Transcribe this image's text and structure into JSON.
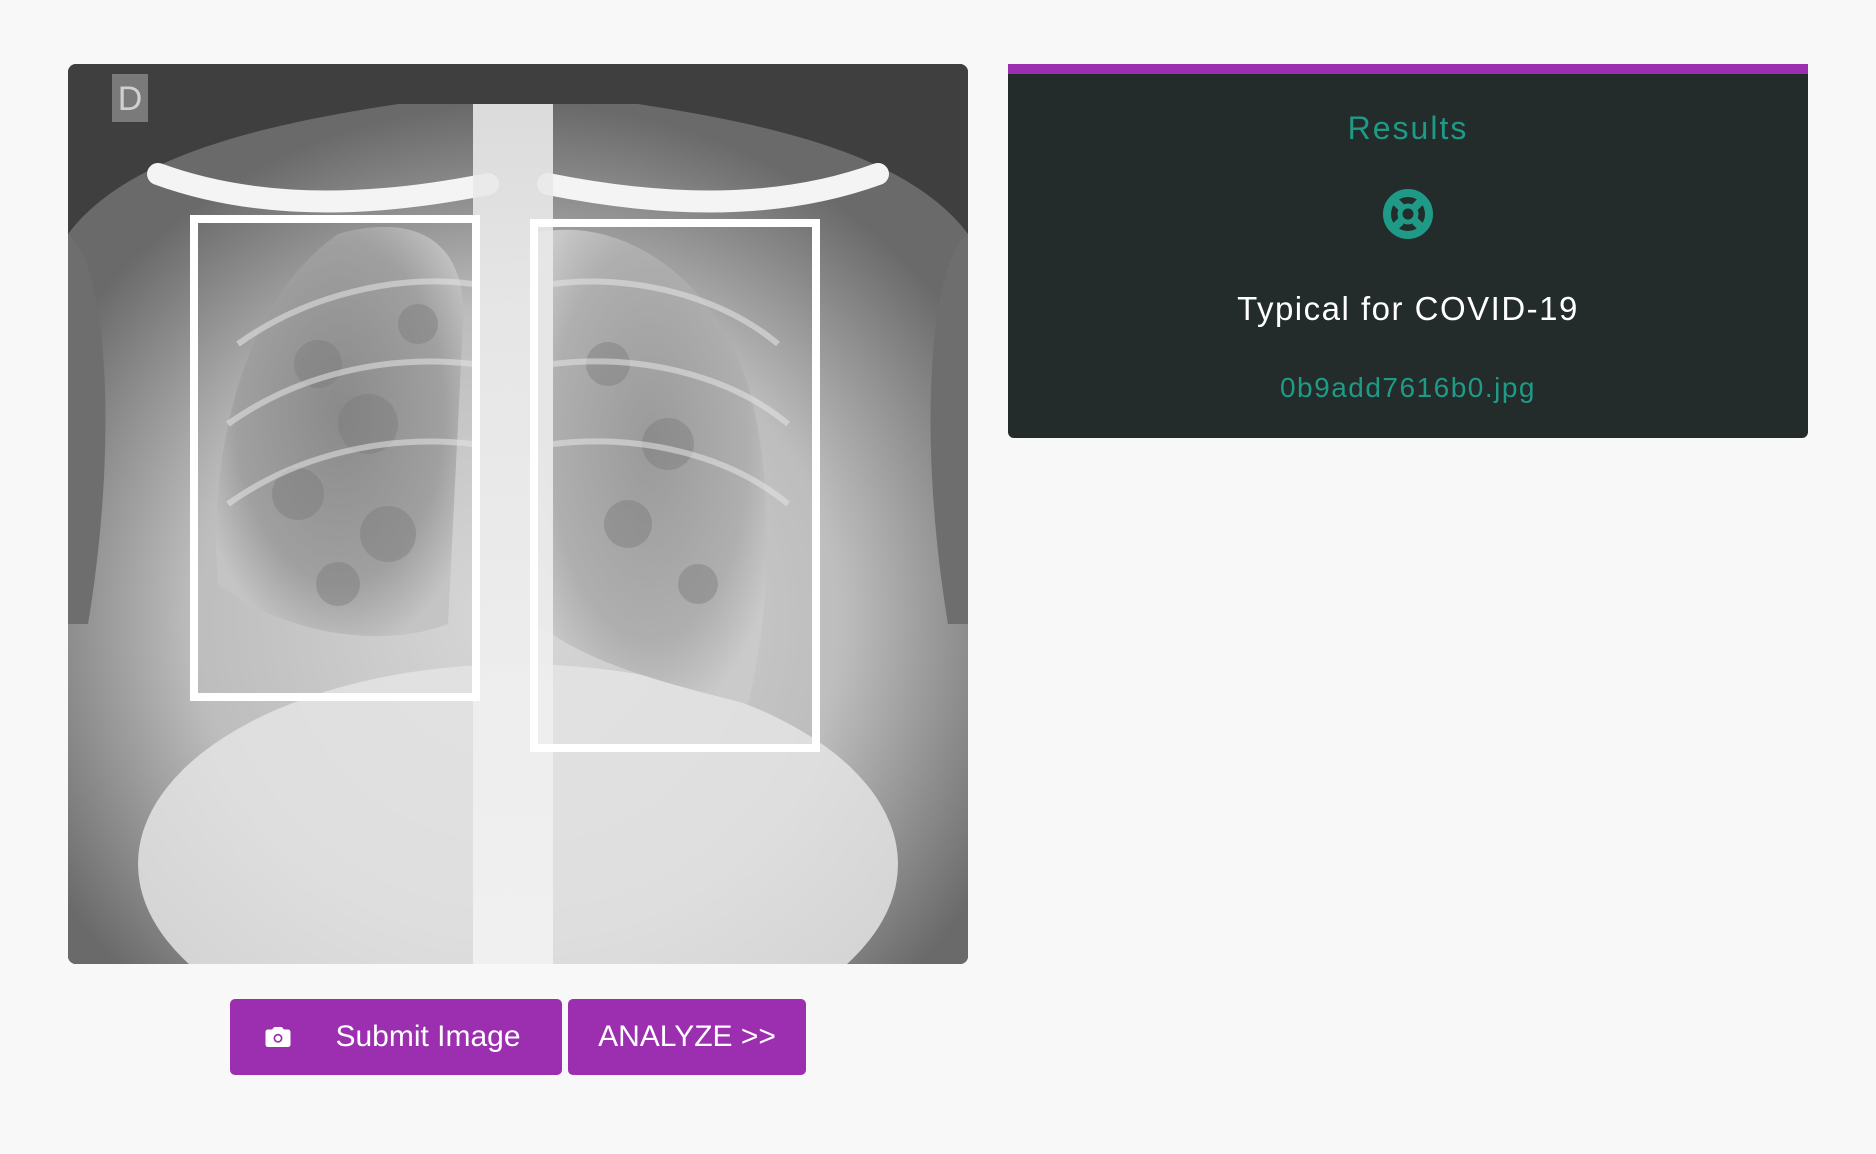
{
  "colors": {
    "accent_purple": "#9c2fb0",
    "accent_teal": "#1f9a87",
    "card_bg": "#232b2b",
    "page_bg": "#f8f8f8"
  },
  "xray": {
    "corner_marker": "D"
  },
  "buttons": {
    "submit_label": "Submit Image",
    "submit_icon": "camera-icon",
    "analyze_label": "ANALYZE >>"
  },
  "results": {
    "title": "Results",
    "status_icon": "lifebuoy-icon",
    "diagnosis": "Typical for COVID-19",
    "filename": "0b9add7616b0.jpg"
  }
}
